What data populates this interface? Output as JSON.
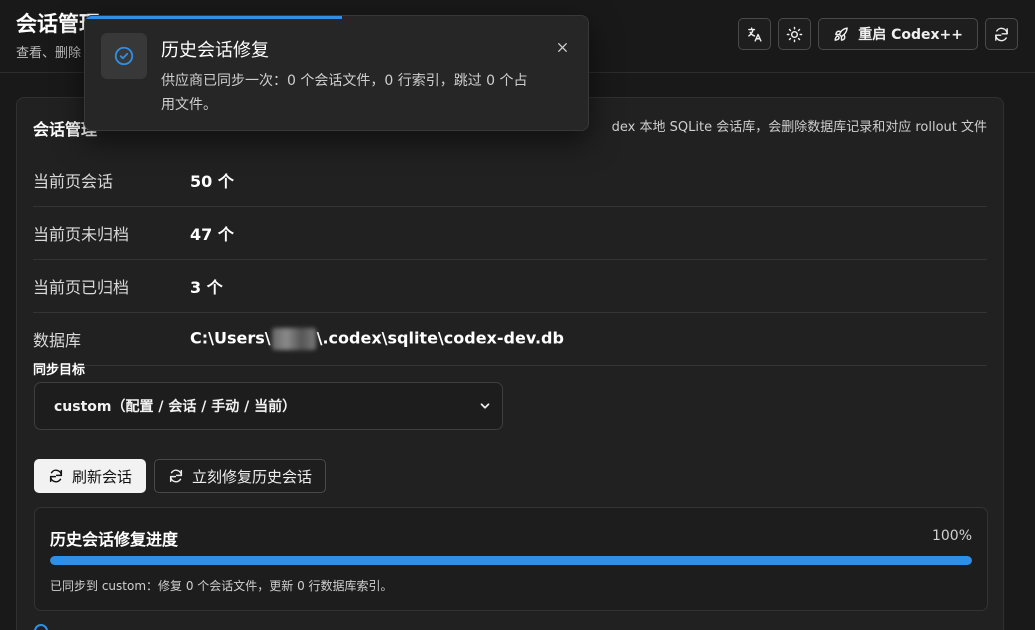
{
  "header": {
    "title": "会话管理",
    "subtitle": "查看、删除",
    "restart_label": "重启 Codex++",
    "icons": [
      "translate-icon",
      "sun-icon",
      "rocket-icon",
      "refresh-icon"
    ]
  },
  "card": {
    "title": "会话管理",
    "description": "dex 本地 SQLite 会话库，会删除数据库记录和对应 rollout 文件",
    "rows": [
      {
        "label": "当前页会话",
        "value": "50 个"
      },
      {
        "label": "当前页未归档",
        "value": "47 个"
      },
      {
        "label": "当前页已归档",
        "value": "3 个"
      },
      {
        "label": "数据库",
        "value_prefix": "C:\\Users\\",
        "value_suffix": "\\.codex\\sqlite\\codex-dev.db"
      }
    ],
    "sync_label": "同步目标",
    "sync_select": {
      "selected": "custom（配置 / 会话 / 手动 / 当前）"
    },
    "refresh_button": "刷新会话",
    "repair_button": "立刻修复历史会话"
  },
  "progress": {
    "title": "历史会话修复进度",
    "percent_text": "100%",
    "percent": 100,
    "message": "已同步到 custom：修复 0 个会话文件，更新 0 行数据库索引。"
  },
  "toast": {
    "title": "历史会话修复",
    "message": "供应商已同步一次：0 个会话文件，0 行索引，跳过 0 个占用文件。",
    "timer_fraction": 0.51
  },
  "colors": {
    "accent": "#2f8fe6",
    "background": "#191919",
    "card": "#212121"
  }
}
